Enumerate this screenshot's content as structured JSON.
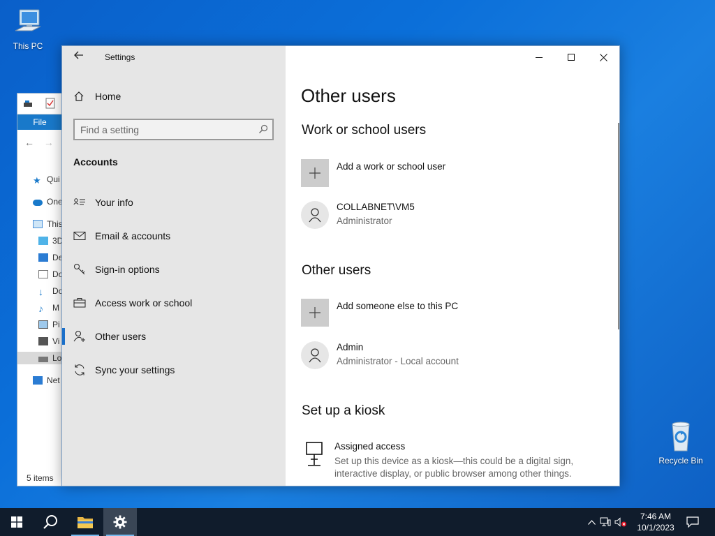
{
  "desktop": {
    "this_pc_label": "This PC",
    "recycle_bin_label": "Recycle Bin"
  },
  "explorer": {
    "file_tab": "File",
    "tree": [
      "Qui",
      "One",
      "This",
      "3D",
      "De",
      "Do",
      "Do",
      "M",
      "Pi",
      "Vi",
      "Lo",
      "Net"
    ],
    "status": "5 items"
  },
  "settings": {
    "title": "Settings",
    "home_label": "Home",
    "search_placeholder": "Find a setting",
    "section_label": "Accounts",
    "nav": [
      {
        "label": "Your info",
        "icon": "contact-card-icon"
      },
      {
        "label": "Email & accounts",
        "icon": "mail-icon"
      },
      {
        "label": "Sign-in options",
        "icon": "key-icon"
      },
      {
        "label": "Access work or school",
        "icon": "briefcase-icon"
      },
      {
        "label": "Other users",
        "icon": "add-user-icon"
      },
      {
        "label": "Sync your settings",
        "icon": "sync-icon"
      }
    ],
    "active_nav": "Other users",
    "page_title": "Other users",
    "work_heading": "Work or school users",
    "add_work_user": "Add a work or school user",
    "work_user": {
      "name": "COLLABNET\\VM5",
      "role": "Administrator"
    },
    "other_heading": "Other users",
    "add_other_user": "Add someone else to this PC",
    "other_user": {
      "name": "Admin",
      "role": "Administrator - Local account"
    },
    "kiosk_heading": "Set up a kiosk",
    "kiosk": {
      "title": "Assigned access",
      "desc": "Set up this device as a kiosk—this could be a digital sign, interactive display, or public browser among other things."
    }
  },
  "taskbar": {
    "time": "7:46 AM",
    "date": "10/1/2023"
  },
  "colors": {
    "accent": "#1a6fc9",
    "sidebar_bg": "#e6e6e6",
    "taskbar_bg": "#101c2c"
  }
}
